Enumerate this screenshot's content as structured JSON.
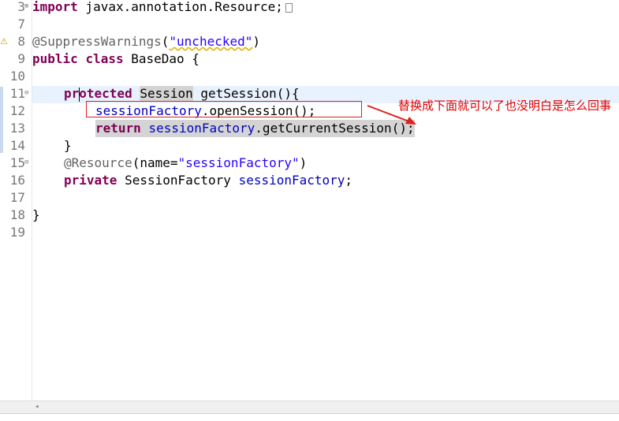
{
  "editor": {
    "line_numbers": [
      "3",
      "7",
      "8",
      "9",
      "10",
      "11",
      "12",
      "13",
      "14",
      "15",
      "16",
      "17",
      "18",
      "19"
    ],
    "fold_markers": {
      "line3": "⊕",
      "line11": "⊖",
      "line15": "⊖"
    },
    "code": {
      "l3_kw": "import",
      "l3_rest": " javax.annotation.Resource;",
      "l8_ann": "@SuppressWarnings",
      "l8_open": "(",
      "l8_str": "\"unchecked\"",
      "l8_close": ")",
      "l9_kw1": "public",
      "l9_kw2": "class",
      "l9_rest": " BaseDao {",
      "l11_kw_a": "pr",
      "l11_kw_b": "otected",
      "l11_type": "Session",
      "l11_rest": " getSession(){",
      "l12_field": "sessionFactory",
      "l12_rest": ".openSession();",
      "l13_kw": "return",
      "l13_field": "sessionFactory",
      "l13_rest": ".getCurrentSession();",
      "l14": "}",
      "l15_ann": "@Resource",
      "l15_open": "(name=",
      "l15_str": "\"sessionFactory\"",
      "l15_close": ")",
      "l16_kw": "private",
      "l16_type": " SessionFactory ",
      "l16_field": "sessionFactory",
      "l16_end": ";",
      "l18": "}"
    }
  },
  "annotation": {
    "note_text": "替换成下面就可以了也没明白是怎么回事",
    "color": "#e00000"
  },
  "scrollbar": {
    "left_arrow": "◂"
  }
}
